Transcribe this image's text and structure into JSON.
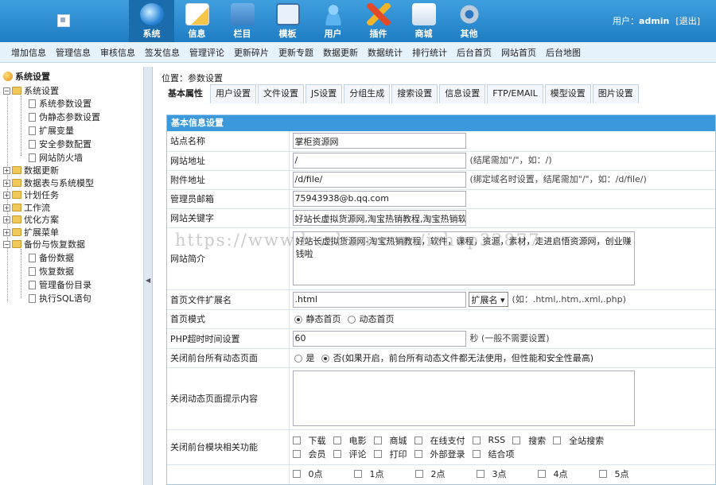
{
  "header": {
    "nav": [
      {
        "label": "系统",
        "icon": "system-icon"
      },
      {
        "label": "信息",
        "icon": "info-icon"
      },
      {
        "label": "栏目",
        "icon": "column-icon"
      },
      {
        "label": "模板",
        "icon": "template-icon"
      },
      {
        "label": "用户",
        "icon": "user-icon"
      },
      {
        "label": "插件",
        "icon": "plugin-icon"
      },
      {
        "label": "商城",
        "icon": "mall-icon"
      },
      {
        "label": "其他",
        "icon": "other-icon"
      }
    ],
    "user_prefix": "用户：",
    "username": "admin",
    "logout": "[退出]"
  },
  "subnav": [
    "增加信息",
    "管理信息",
    "审核信息",
    "签发信息",
    "管理评论",
    "更新碎片",
    "更新专题",
    "数据更新",
    "数据统计",
    "排行统计",
    "后台首页",
    "网站首页",
    "后台地图"
  ],
  "sidebar": {
    "root": "系统设置",
    "items": [
      {
        "label": "系统设置"
      },
      {
        "label": "系统参数设置"
      },
      {
        "label": "伪静态参数设置"
      },
      {
        "label": "扩展变量"
      },
      {
        "label": "安全参数配置"
      },
      {
        "label": "网站防火墙"
      },
      {
        "label": "数据更新"
      },
      {
        "label": "数据表与系统模型"
      },
      {
        "label": "计划任务"
      },
      {
        "label": "工作流"
      },
      {
        "label": "优化方案"
      },
      {
        "label": "扩展菜单"
      },
      {
        "label": "备份与恢复数据"
      },
      {
        "label": "备份数据"
      },
      {
        "label": "恢复数据"
      },
      {
        "label": "管理备份目录"
      },
      {
        "label": "执行SQL语句"
      }
    ]
  },
  "content": {
    "position": "位置：参数设置",
    "tabs": [
      "基本属性",
      "用户设置",
      "文件设置",
      "JS设置",
      "分组生成",
      "搜索设置",
      "信息设置",
      "FTP/EMAIL",
      "模型设置",
      "图片设置"
    ],
    "form_title": "基本信息设置",
    "watermark": "https://www.huzhan.com/ishop32877",
    "fields": {
      "site_name": {
        "label": "站点名称",
        "value": "掌柜资源网"
      },
      "site_url": {
        "label": "网站地址",
        "value": "/",
        "hint": "(结尾需加\"/\"，如：/)"
      },
      "attach_url": {
        "label": "附件地址",
        "value": "/d/file/",
        "hint": "(绑定域名时设置，结尾需加\"/\"，如：/d/file/)"
      },
      "admin_email": {
        "label": "管理员邮箱",
        "value": "75943938@b.qq.com"
      },
      "keywords": {
        "label": "网站关键字",
        "value": "好站长虚拟货源网,淘宝热销教程,淘宝热销软"
      },
      "intro": {
        "label": "网站简介",
        "value": "好站长虚拟货源网-淘宝热销教程，软件，课程，资源，素材，走进启悟资源网，创业赚钱啦"
      },
      "index_ext": {
        "label": "首页文件扩展名",
        "value": ".html",
        "select": "扩展名",
        "hint": "(如：.html,.htm,.xml,.php)"
      },
      "index_mode": {
        "label": "首页模式",
        "options": [
          "静态首页",
          "动态首页"
        ]
      },
      "php_timeout": {
        "label": "PHP超时时间设置",
        "value": "60",
        "hint": "秒 (一般不需要设置)"
      },
      "close_dynamic": {
        "label": "关闭前台所有动态页面",
        "yes": "是",
        "no": "否(如果开启，前台所有动态文件都无法使用，但性能和安全性最高)"
      },
      "close_tip": {
        "label": "关闭动态页面提示内容",
        "value": ""
      },
      "close_modules": {
        "label": "关闭前台模块相关功能",
        "row1": [
          "下载",
          "电影",
          "商城",
          "在线支付",
          "RSS",
          "搜索",
          "全站搜索"
        ],
        "row2": [
          "会员",
          "评论",
          "打印",
          "外部登录",
          "结合项"
        ]
      },
      "hours": [
        "0点",
        "1点",
        "2点",
        "3点",
        "4点",
        "5点"
      ]
    }
  },
  "colors": {
    "header": "#2a86d0",
    "accent": "#3b98da",
    "subnav_bg": "#e6f2fc"
  }
}
